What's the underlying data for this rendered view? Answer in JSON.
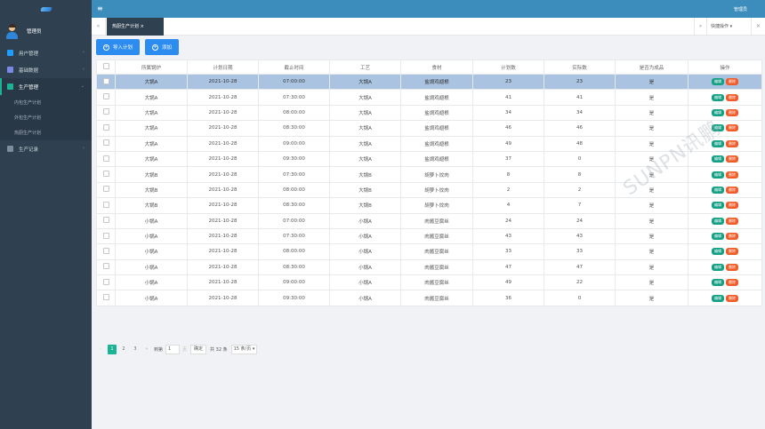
{
  "sidebar": {
    "user_name": "管理员",
    "items": [
      {
        "label": "用户管理",
        "arrow": "‹",
        "color": "#1e9fff"
      },
      {
        "label": "基础数据",
        "arrow": "‹",
        "color": "#7b89e6"
      },
      {
        "label": "生产管理",
        "arrow": "⌄",
        "color": "#1ab394"
      },
      {
        "label": "生产记录",
        "arrow": "‹",
        "color": "#7f8c9a"
      }
    ],
    "sub_items": [
      "内包生产计划",
      "外包生产计划",
      "热厨生产计划"
    ]
  },
  "topbar": {
    "menu_icon": "≡",
    "admin_label": "管理员"
  },
  "tabbar": {
    "nav_left": "«",
    "active_tab": "热厨生产计划 ×",
    "nav_right": "»",
    "quick_label": "快捷操作 ▾",
    "close_icon": "✕"
  },
  "toolbar": {
    "import_label": "导入计划",
    "add_label": "添加"
  },
  "table": {
    "headers": [
      "",
      "所属锅炉",
      "计划日期",
      "截止时间",
      "工艺",
      "食材",
      "计划数",
      "实际数",
      "是否为成品",
      "操作"
    ],
    "op_edit": "编辑",
    "op_delete": "删除",
    "rows": [
      [
        "大锅A",
        "2021-10-28",
        "07:00:00",
        "大锅A",
        "盐焗鸡翅根",
        "23",
        "23",
        "是"
      ],
      [
        "大锅A",
        "2021-10-28",
        "07:30:00",
        "大锅A",
        "盐焗鸡翅根",
        "41",
        "41",
        "是"
      ],
      [
        "大锅A",
        "2021-10-28",
        "08:00:00",
        "大锅A",
        "盐焗鸡翅根",
        "34",
        "34",
        "是"
      ],
      [
        "大锅A",
        "2021-10-28",
        "08:30:00",
        "大锅A",
        "盐焗鸡翅根",
        "46",
        "46",
        "是"
      ],
      [
        "大锅A",
        "2021-10-28",
        "09:00:00",
        "大锅A",
        "盐焗鸡翅根",
        "49",
        "48",
        "是"
      ],
      [
        "大锅A",
        "2021-10-28",
        "09:30:00",
        "大锅A",
        "盐焗鸡翅根",
        "37",
        "0",
        "是"
      ],
      [
        "大锅B",
        "2021-10-28",
        "07:30:00",
        "大锅B",
        "胡萝卜炆肉",
        "8",
        "8",
        "是"
      ],
      [
        "大锅B",
        "2021-10-28",
        "08:00:00",
        "大锅B",
        "胡萝卜炆肉",
        "2",
        "2",
        "是"
      ],
      [
        "大锅B",
        "2021-10-28",
        "08:30:00",
        "大锅B",
        "胡萝卜炆肉",
        "4",
        "7",
        "是"
      ],
      [
        "小锅A",
        "2021-10-28",
        "07:00:00",
        "小锅A",
        "肉酱豆腐丝",
        "24",
        "24",
        "是"
      ],
      [
        "小锅A",
        "2021-10-28",
        "07:30:00",
        "小锅A",
        "肉酱豆腐丝",
        "43",
        "43",
        "是"
      ],
      [
        "小锅A",
        "2021-10-28",
        "08:00:00",
        "小锅A",
        "肉酱豆腐丝",
        "33",
        "33",
        "是"
      ],
      [
        "小锅A",
        "2021-10-28",
        "08:30:00",
        "小锅A",
        "肉酱豆腐丝",
        "47",
        "47",
        "是"
      ],
      [
        "小锅A",
        "2021-10-28",
        "09:00:00",
        "小锅A",
        "肉酱豆腐丝",
        "49",
        "22",
        "是"
      ],
      [
        "小锅A",
        "2021-10-28",
        "09:30:00",
        "小锅A",
        "肉酱豆腐丝",
        "36",
        "0",
        "是"
      ]
    ]
  },
  "pager": {
    "prev": "‹",
    "pages": [
      "1",
      "2",
      "3"
    ],
    "next": "›",
    "goto_label": "到第",
    "goto_value": "1",
    "page_unit": "页",
    "confirm_label": "确定",
    "total_label": "共 32 条",
    "page_size": "15 条/页 ▾"
  },
  "watermark": "SUNPN讯鹏"
}
